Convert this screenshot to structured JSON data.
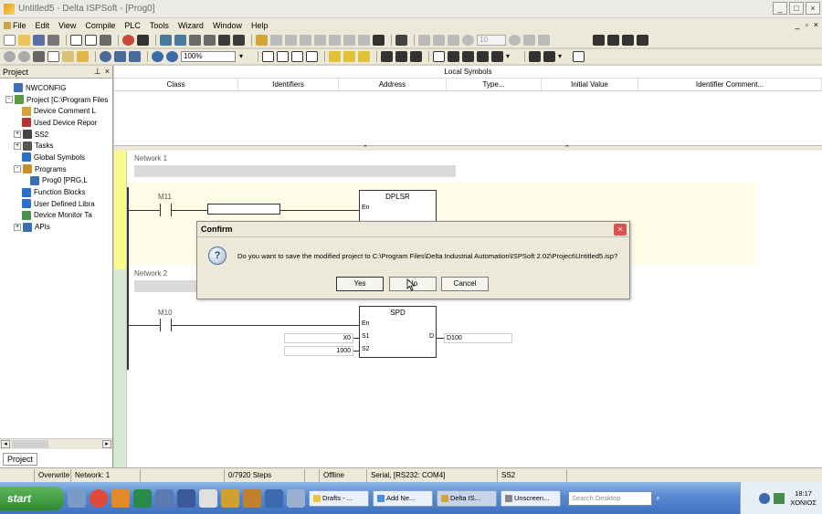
{
  "window": {
    "title": "Untitled5 - Delta ISPSoft - [Prog0]",
    "controls": [
      "_",
      "□",
      "×"
    ]
  },
  "menu": {
    "items": [
      "File",
      "Edit",
      "View",
      "Compile",
      "PLC",
      "Tools",
      "Wizard",
      "Window",
      "Help"
    ],
    "right_controls": [
      "_",
      "▫",
      "×"
    ]
  },
  "toolbar": {
    "zoom": "100%",
    "step_value": "10"
  },
  "project_panel": {
    "header": "Project",
    "pin": "⊥",
    "close": "×",
    "tree": [
      {
        "label": "NWCONFIG",
        "indent": 1,
        "expander": "",
        "icon_color": "#3a6fb5"
      },
      {
        "label": "Project [C:\\Program Files",
        "indent": 0,
        "expander": "-",
        "icon_color": "#5a9b4a"
      },
      {
        "label": "Device Comment L",
        "indent": 2,
        "expander": "",
        "icon_color": "#d6a33a"
      },
      {
        "label": "Used Device Repor",
        "indent": 2,
        "expander": "",
        "icon_color": "#b83232"
      },
      {
        "label": "SS2",
        "indent": 1,
        "expander": "+",
        "icon_color": "#444444"
      },
      {
        "label": "Tasks",
        "indent": 1,
        "expander": "+",
        "icon_color": "#555555"
      },
      {
        "label": "Global Symbols",
        "indent": 2,
        "expander": "",
        "icon_color": "#2c6fd1"
      },
      {
        "label": "Programs",
        "indent": 1,
        "expander": "-",
        "icon_color": "#c9902a"
      },
      {
        "label": "Prog0 [PRG,L",
        "indent": 3,
        "expander": "",
        "icon_color": "#3a6fb5"
      },
      {
        "label": "Function Blocks",
        "indent": 2,
        "expander": "",
        "icon_color": "#2c6fd1"
      },
      {
        "label": "User Defined Libra",
        "indent": 2,
        "expander": "",
        "icon_color": "#2c6fd1"
      },
      {
        "label": "Device Monitor Ta",
        "indent": 2,
        "expander": "",
        "icon_color": "#4a8f4a"
      },
      {
        "label": "APIs",
        "indent": 1,
        "expander": "+",
        "icon_color": "#3a6fb5"
      }
    ],
    "bottom_tab": "Project"
  },
  "local_symbols": {
    "title": "Local Symbols",
    "columns": [
      "Class",
      "Identifiers",
      "Address",
      "Type...",
      "Initial Value",
      "Identifier Comment..."
    ]
  },
  "ladder": {
    "network1": {
      "label": "Network 1",
      "contact": "M11",
      "block_name": "DPLSR",
      "en_pin": "En"
    },
    "network2": {
      "label": "Network 2",
      "contact": "M10",
      "block_name": "SPD",
      "pins": {
        "en": "En",
        "s1": "S1",
        "s2": "S2",
        "d": "D"
      },
      "s1_value": "X0",
      "s2_value": "1000",
      "d_value": "D100"
    }
  },
  "dialog": {
    "title": "Confirm",
    "icon": "?",
    "message": "Do you want to save the modified project to C:\\Program Files\\Delta Industrial Automation\\ISPSoft 2.02\\Project\\Untitled5.isp?",
    "buttons": {
      "yes": "Yes",
      "no": "No",
      "cancel": "Cancel"
    },
    "close": "×"
  },
  "status_bar": {
    "mode": "Overwrite",
    "network": "Network: 1",
    "steps": "0/7920 Steps",
    "connection": "Offline",
    "port": "Serial, [RS232: COM4]",
    "model": "SS2"
  },
  "taskbar": {
    "start": "start",
    "tasks": [
      {
        "label": "Drafts - ...",
        "color": "#f0c040"
      },
      {
        "label": "Add Ne...",
        "color": "#4a8fe0"
      },
      {
        "label": "Delta IS...",
        "color": "#d6a33a",
        "active": true
      },
      {
        "label": "Unscreen...",
        "color": "#888888"
      }
    ],
    "search_placeholder": "Search Desktop",
    "time": "18:17",
    "day": "ΧΟΝΙΟΣ"
  }
}
